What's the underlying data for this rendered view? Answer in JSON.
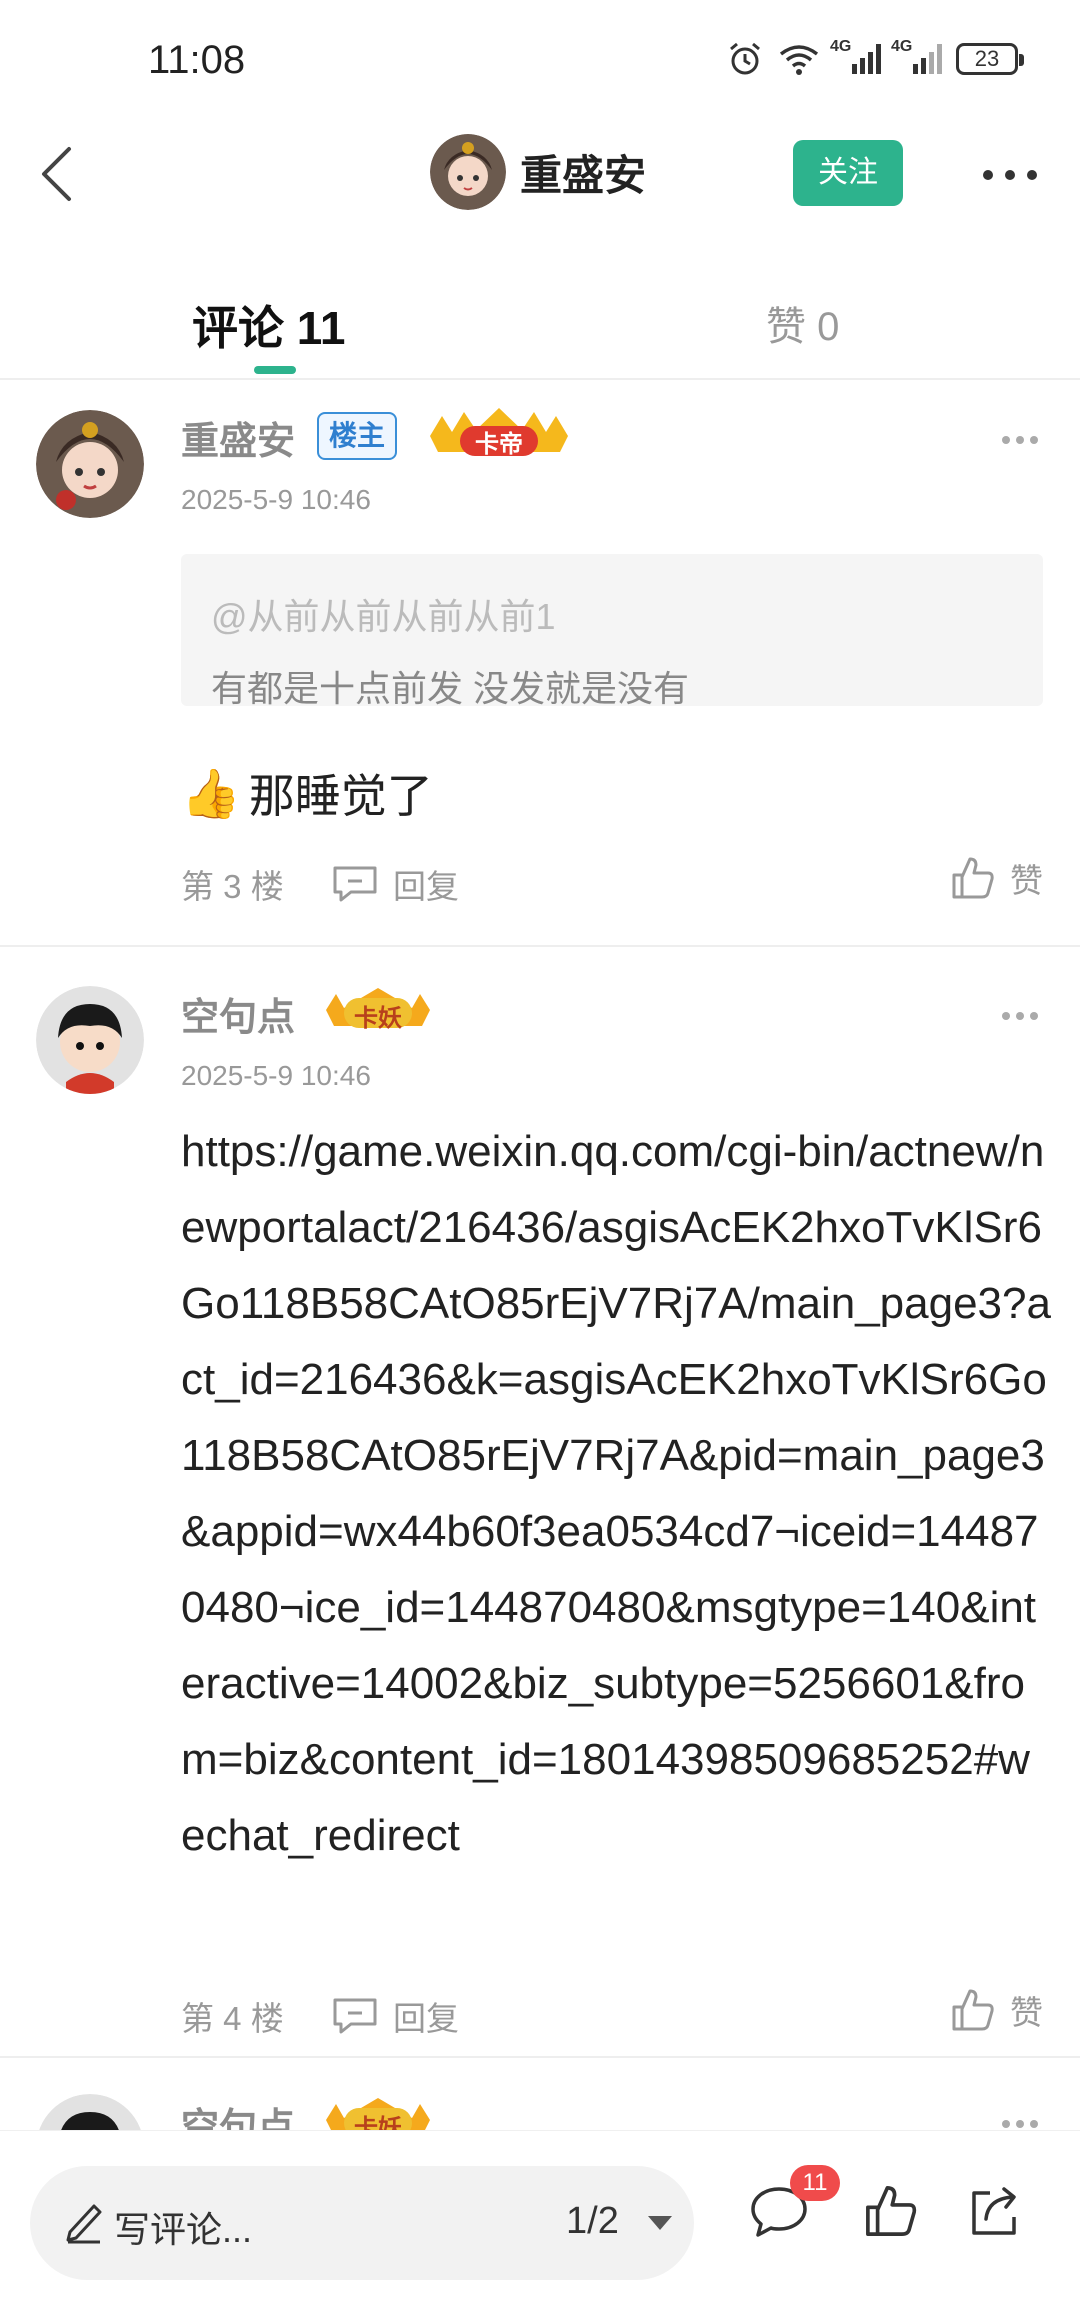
{
  "status_bar": {
    "time": "11:08",
    "network_1": "4G",
    "network_2": "4G",
    "battery": "23"
  },
  "nav": {
    "title": "重盛安",
    "follow_label": "关注"
  },
  "tabs": {
    "comments_label": "评论 11",
    "likes_label": "赞 0"
  },
  "comments": [
    {
      "user": "重盛安",
      "op_badge": "楼主",
      "rank_badge": "卡帝",
      "time": "2025-5-9 10:46",
      "quote_user": "@从前从前从前从前1",
      "quote_text": "有都是十点前发 没发就是没有",
      "emoji": "👍",
      "text": "那睡觉了",
      "floor": "第 3 楼",
      "reply_label": "回复",
      "like_label": "赞"
    },
    {
      "user": "空句点",
      "rank_badge": "卡妖",
      "time": "2025-5-9 10:46",
      "text": "https://game.weixin.qq.com/cgi-bin/actnew/newportalact/216436/asgisAcEK2hxoTvKlSr6Go118B58CAtO85rEjV7Rj7A/main_page3?act_id=216436&k=asgisAcEK2hxoTvKlSr6Go118B58CAtO85rEjV7Rj7A&pid=main_page3&appid=wx44b60f3ea0534cd7¬iceid=144870480¬ice_id=144870480&msgtype=140&interactive=14002&biz_subtype=5256601&from=biz&content_id=18014398509685252#wechat_redirect",
      "floor": "第 4 楼",
      "reply_label": "回复",
      "like_label": "赞"
    },
    {
      "user": "空句点",
      "rank_badge": "卡妖"
    }
  ],
  "bottom_bar": {
    "write_placeholder": "写评论...",
    "page_indicator": "1/2",
    "comment_count": "11"
  },
  "colors": {
    "accent": "#2db38d",
    "badge_red": "#f04b4b",
    "op_badge_blue": "#2f7fcf"
  },
  "icons": [
    "back-icon",
    "more-icon",
    "reply-icon",
    "thumbs-up-icon",
    "pen-icon",
    "comment-icon",
    "share-icon",
    "alarm-icon",
    "wifi-icon",
    "signal-icon",
    "battery-icon"
  ]
}
